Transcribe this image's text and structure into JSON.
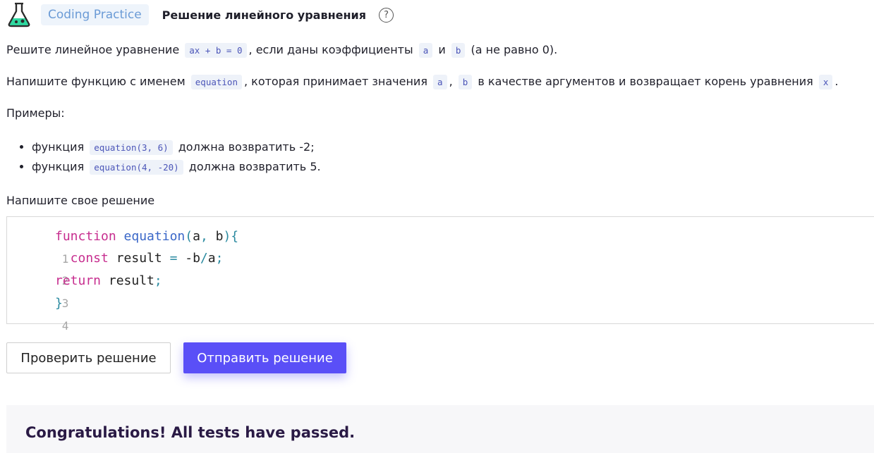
{
  "header": {
    "icon": "flask-icon",
    "badge": "Coding Practice",
    "title": "Решение линейного уравнения",
    "help": "?"
  },
  "task": {
    "p1": {
      "before": "Решите линейное уравнение",
      "code1": "ax + b = 0",
      "mid1": ", если даны коэффициенты",
      "code2": "a",
      "mid2": "и",
      "code3": "b",
      "after": "(a не равно 0)."
    },
    "p2": {
      "before": "Напишите функцию с именем",
      "code1": "equation",
      "mid1": ", которая принимает значения",
      "code2": "a",
      "sep": ",",
      "code3": "b",
      "mid2": "в качестве аргументов и возвращает корень уравнения",
      "code4": "x",
      "after": "."
    },
    "examples_label": "Примеры:",
    "examples": [
      {
        "before": "функция",
        "code": "equation(3, 6)",
        "after": "должна возвратить -2;"
      },
      {
        "before": "функция",
        "code": "equation(4, -20)",
        "after": "должна возвратить 5."
      }
    ]
  },
  "editor": {
    "label": "Напишите свое решение",
    "line_numbers": [
      "1",
      "2",
      "3",
      "4"
    ],
    "lines": [
      {
        "t1": "function",
        "t2": " ",
        "t3": "equation",
        "t4": "(",
        "t5": "a",
        "t6": ", ",
        "t7": "b",
        "t8": "){"
      },
      {
        "t1": "  const",
        "t2": " result ",
        "t3": "=",
        "t4": " -b",
        "t5": "/",
        "t6": "a",
        "t7": ";"
      },
      {
        "t1": "return",
        "t2": " result",
        "t3": ";"
      },
      {
        "t1": "}"
      }
    ]
  },
  "buttons": {
    "check": "Проверить решение",
    "submit": "Отправить решение"
  },
  "result": {
    "message": "Congratulations! All tests have passed."
  },
  "colors": {
    "primary": "#5a4ff7",
    "badge_bg": "#eef4fb",
    "keyword": "#c72e8f",
    "function": "#3a67c8"
  }
}
